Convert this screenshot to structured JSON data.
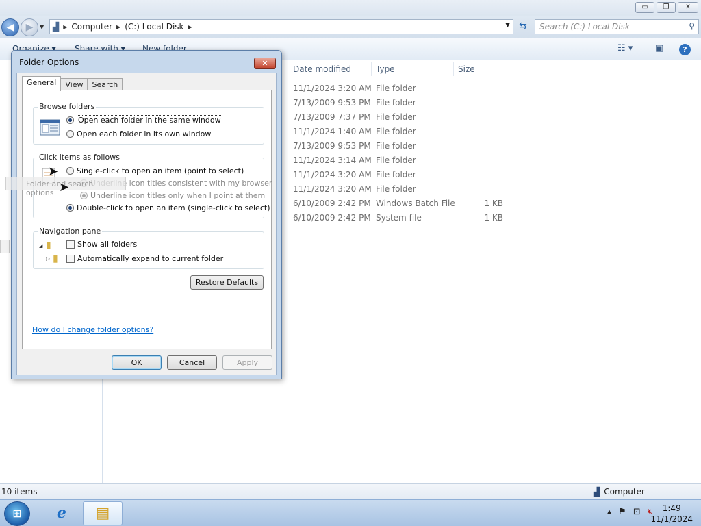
{
  "window": {
    "title_buttons": [
      "▭",
      "❐",
      "✕"
    ]
  },
  "address": {
    "crumbs": [
      "Computer",
      "(C:) Local Disk"
    ],
    "search_placeholder": "Search (C:) Local Disk"
  },
  "toolbar": {
    "organize": "Organize ▾",
    "share_with": "Share with ▾",
    "new_folder": "New folder"
  },
  "columns": {
    "date_modified": "Date modified",
    "type": "Type",
    "size": "Size"
  },
  "files": [
    {
      "date": "11/1/2024 3:20 AM",
      "type": "File folder",
      "size": ""
    },
    {
      "date": "7/13/2009 9:53 PM",
      "type": "File folder",
      "size": ""
    },
    {
      "date": "7/13/2009 7:37 PM",
      "type": "File folder",
      "size": ""
    },
    {
      "date": "11/1/2024 1:40 AM",
      "type": "File folder",
      "size": ""
    },
    {
      "date": "7/13/2009 9:53 PM",
      "type": "File folder",
      "size": ""
    },
    {
      "date": "11/1/2024 3:14 AM",
      "type": "File folder",
      "size": ""
    },
    {
      "date": "11/1/2024 3:20 AM",
      "type": "File folder",
      "size": ""
    },
    {
      "date": "11/1/2024 3:20 AM",
      "type": "File folder",
      "size": ""
    },
    {
      "date": "6/10/2009 2:42 PM",
      "type": "Windows Batch File",
      "size": "1 KB"
    },
    {
      "date": "6/10/2009 2:42 PM",
      "type": "System file",
      "size": "1 KB"
    }
  ],
  "status": {
    "item_count": "10 items",
    "location": "Computer"
  },
  "taskbar": {
    "time": "1:49",
    "date": "11/1/2024"
  },
  "dialog": {
    "title": "Folder Options",
    "tabs": [
      "General",
      "View",
      "Search"
    ],
    "browse_folders": {
      "label": "Browse folders",
      "opt_same": "Open each folder in the same window",
      "opt_own": "Open each folder in its own window"
    },
    "click_items": {
      "label": "Click items as follows",
      "opt_single": "Single-click to open an item (point to select)",
      "opt_underline_browser": "Underline icon titles consistent with my browser",
      "opt_underline_point": "Underline icon titles only when I point at them",
      "opt_double": "Double-click to open an item (single-click to select)"
    },
    "nav_pane": {
      "label": "Navigation pane",
      "opt_show_all": "Show all folders",
      "opt_expand": "Automatically expand to current folder"
    },
    "restore_defaults": "Restore Defaults",
    "help_link": "How do I change folder options?",
    "ok": "OK",
    "cancel": "Cancel",
    "apply": "Apply"
  },
  "drag_ghost": "Folder and search options",
  "colors": {
    "accent": "#2b63b0",
    "link": "#0066cc",
    "close_red": "#c2432c"
  }
}
